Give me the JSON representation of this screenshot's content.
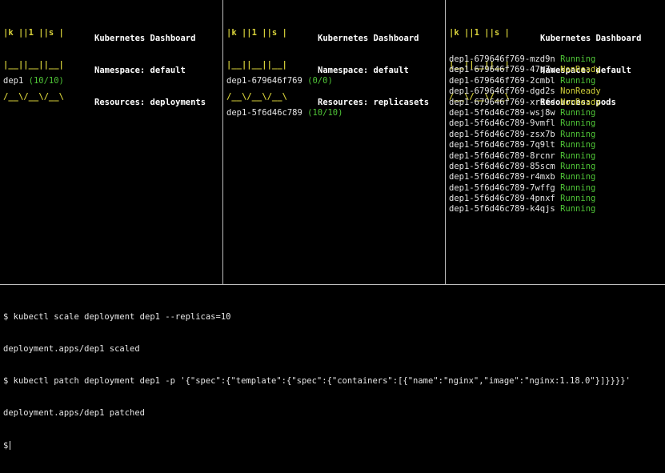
{
  "dashboards": [
    {
      "logo": [
        "|k ||1 ||s |",
        "|__||__||__|",
        "/__\\/__\\/__\\"
      ],
      "title": "Kubernetes Dashboard",
      "namespace": "Namespace: default",
      "resources": "Resources: deployments",
      "items": [
        {
          "name": "dep1",
          "status": "(10/10)",
          "status_color": "green"
        }
      ]
    },
    {
      "logo": [
        "|k ||1 ||s |",
        "|__||__||__|",
        "/__\\/__\\/__\\"
      ],
      "title": "Kubernetes Dashboard",
      "namespace": "Namespace: default",
      "resources": "Resources: replicasets",
      "items": [
        {
          "name": "dep1-679646f769",
          "status": "(0/0)",
          "status_color": "green"
        },
        {
          "name": "dep1-5f6d46c789",
          "status": "(10/10)",
          "status_color": "green"
        }
      ]
    },
    {
      "logo": [
        "|k ||1 ||s |",
        "|__||__||__|",
        "/__\\/__\\/__\\"
      ],
      "title": "Kubernetes Dashboard",
      "namespace": "Namespace: default",
      "resources": "Resources: pods",
      "items": [
        {
          "name": "dep1-679646f769-mzd9n",
          "status": "Running",
          "status_color": "green"
        },
        {
          "name": "dep1-679646f769-47q7w",
          "status": "NonReady",
          "status_color": "yellow"
        },
        {
          "name": "dep1-679646f769-2cmbl",
          "status": "Running",
          "status_color": "green"
        },
        {
          "name": "dep1-679646f769-dgd2s",
          "status": "NonReady",
          "status_color": "yellow"
        },
        {
          "name": "dep1-679646f769-xr6fd",
          "status": "NonReady",
          "status_color": "yellow"
        },
        {
          "name": "dep1-5f6d46c789-wsj8w",
          "status": "Running",
          "status_color": "green"
        },
        {
          "name": "dep1-5f6d46c789-9vmfl",
          "status": "Running",
          "status_color": "green"
        },
        {
          "name": "dep1-5f6d46c789-zsx7b",
          "status": "Running",
          "status_color": "green"
        },
        {
          "name": "dep1-5f6d46c789-7q9lt",
          "status": "Running",
          "status_color": "green"
        },
        {
          "name": "dep1-5f6d46c789-8rcnr",
          "status": "Running",
          "status_color": "green"
        },
        {
          "name": "dep1-5f6d46c789-85scm",
          "status": "Running",
          "status_color": "green"
        },
        {
          "name": "dep1-5f6d46c789-r4mxb",
          "status": "Running",
          "status_color": "green"
        },
        {
          "name": "dep1-5f6d46c789-7wffg",
          "status": "Running",
          "status_color": "green"
        },
        {
          "name": "dep1-5f6d46c789-4pnxf",
          "status": "Running",
          "status_color": "green"
        },
        {
          "name": "dep1-5f6d46c789-k4qjs",
          "status": "Running",
          "status_color": "green"
        }
      ]
    }
  ],
  "terminal": {
    "lines": [
      "$ kubectl scale deployment dep1 --replicas=10",
      "deployment.apps/dep1 scaled",
      "$ kubectl patch deployment dep1 -p '{\"spec\":{\"template\":{\"spec\":{\"containers\":[{\"name\":\"nginx\",\"image\":\"nginx:1.18.0\"}]}}}}'",
      "deployment.apps/dep1 patched"
    ],
    "prompt": "$"
  },
  "colors": {
    "green": "#4fc437",
    "yellow": "#cfcf39",
    "logo": "#d8d23a",
    "divider": "#bdbdbd"
  }
}
